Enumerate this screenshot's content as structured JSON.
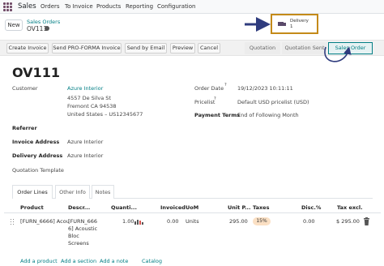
{
  "nav": {
    "app_name": "Sales",
    "menu": [
      "Orders",
      "To Invoice",
      "Products",
      "Reporting",
      "Configuration"
    ]
  },
  "control": {
    "new_label": "New",
    "breadcrumb": "Sales Orders",
    "record_name": "OV111"
  },
  "smart_button": {
    "label": "Delivery",
    "count": "1",
    "icon": "truck-icon",
    "highlight_color": "#c48a19"
  },
  "actions": {
    "create_invoice": "Create Invoice",
    "send_proforma": "Send PRO-FORMA Invoice",
    "send_email": "Send by Email",
    "preview": "Preview",
    "cancel": "Cancel"
  },
  "stages": {
    "quotation": "Quotation",
    "quotation_sent": "Quotation Sent",
    "sales_order": "Sales Order",
    "active": "Sales Order"
  },
  "form": {
    "title": "OV111",
    "customer_label": "Customer",
    "customer_name": "Azure Interior",
    "address_line1": "4557 De Silva St",
    "address_line2": "Fremont CA 94538",
    "address_line3": "United States – US12345677",
    "referrer_label": "Referrer",
    "invoice_address_label": "Invoice Address",
    "invoice_address": "Azure Interior",
    "delivery_address_label": "Delivery Address",
    "delivery_address": "Azure Interior",
    "quotation_template_label": "Quotation Template",
    "order_date_label": "Order Date",
    "order_date_help": "?",
    "order_date": "19/12/2023 10:11:11",
    "pricelist_label": "Pricelist",
    "pricelist_help": "?",
    "pricelist": "Default USD pricelist (USD)",
    "payment_terms_label": "Payment Terms",
    "payment_terms": "End of Following Month"
  },
  "tabs": {
    "order_lines": "Order Lines",
    "other_info": "Other Info",
    "notes": "Notes"
  },
  "table": {
    "headers": {
      "product": "Product",
      "description": "Descr...",
      "quantity": "Quanti...",
      "invoiced": "Invoiced",
      "uom": "UoM",
      "unit_price": "Unit P...",
      "taxes": "Taxes",
      "discount": "Disc.%",
      "tax_excl": "Tax excl."
    },
    "row": {
      "product": "[FURN_6666] Acou",
      "desc_1": "[FURN_666",
      "desc_2": "6] Acoustic",
      "desc_3": "Bloc",
      "desc_4": "Screens",
      "quantity": "1.00",
      "invoiced": "0.00",
      "uom": "Units",
      "unit_price": "295.00",
      "tax": "15%",
      "discount": "0.00",
      "subtotal": "$ 295.00"
    }
  },
  "footer": {
    "add_product": "Add a product",
    "add_section": "Add a section",
    "add_note": "Add a note",
    "catalog": "Catalog"
  },
  "colors": {
    "accent": "#017e84",
    "brand": "#714b67"
  }
}
